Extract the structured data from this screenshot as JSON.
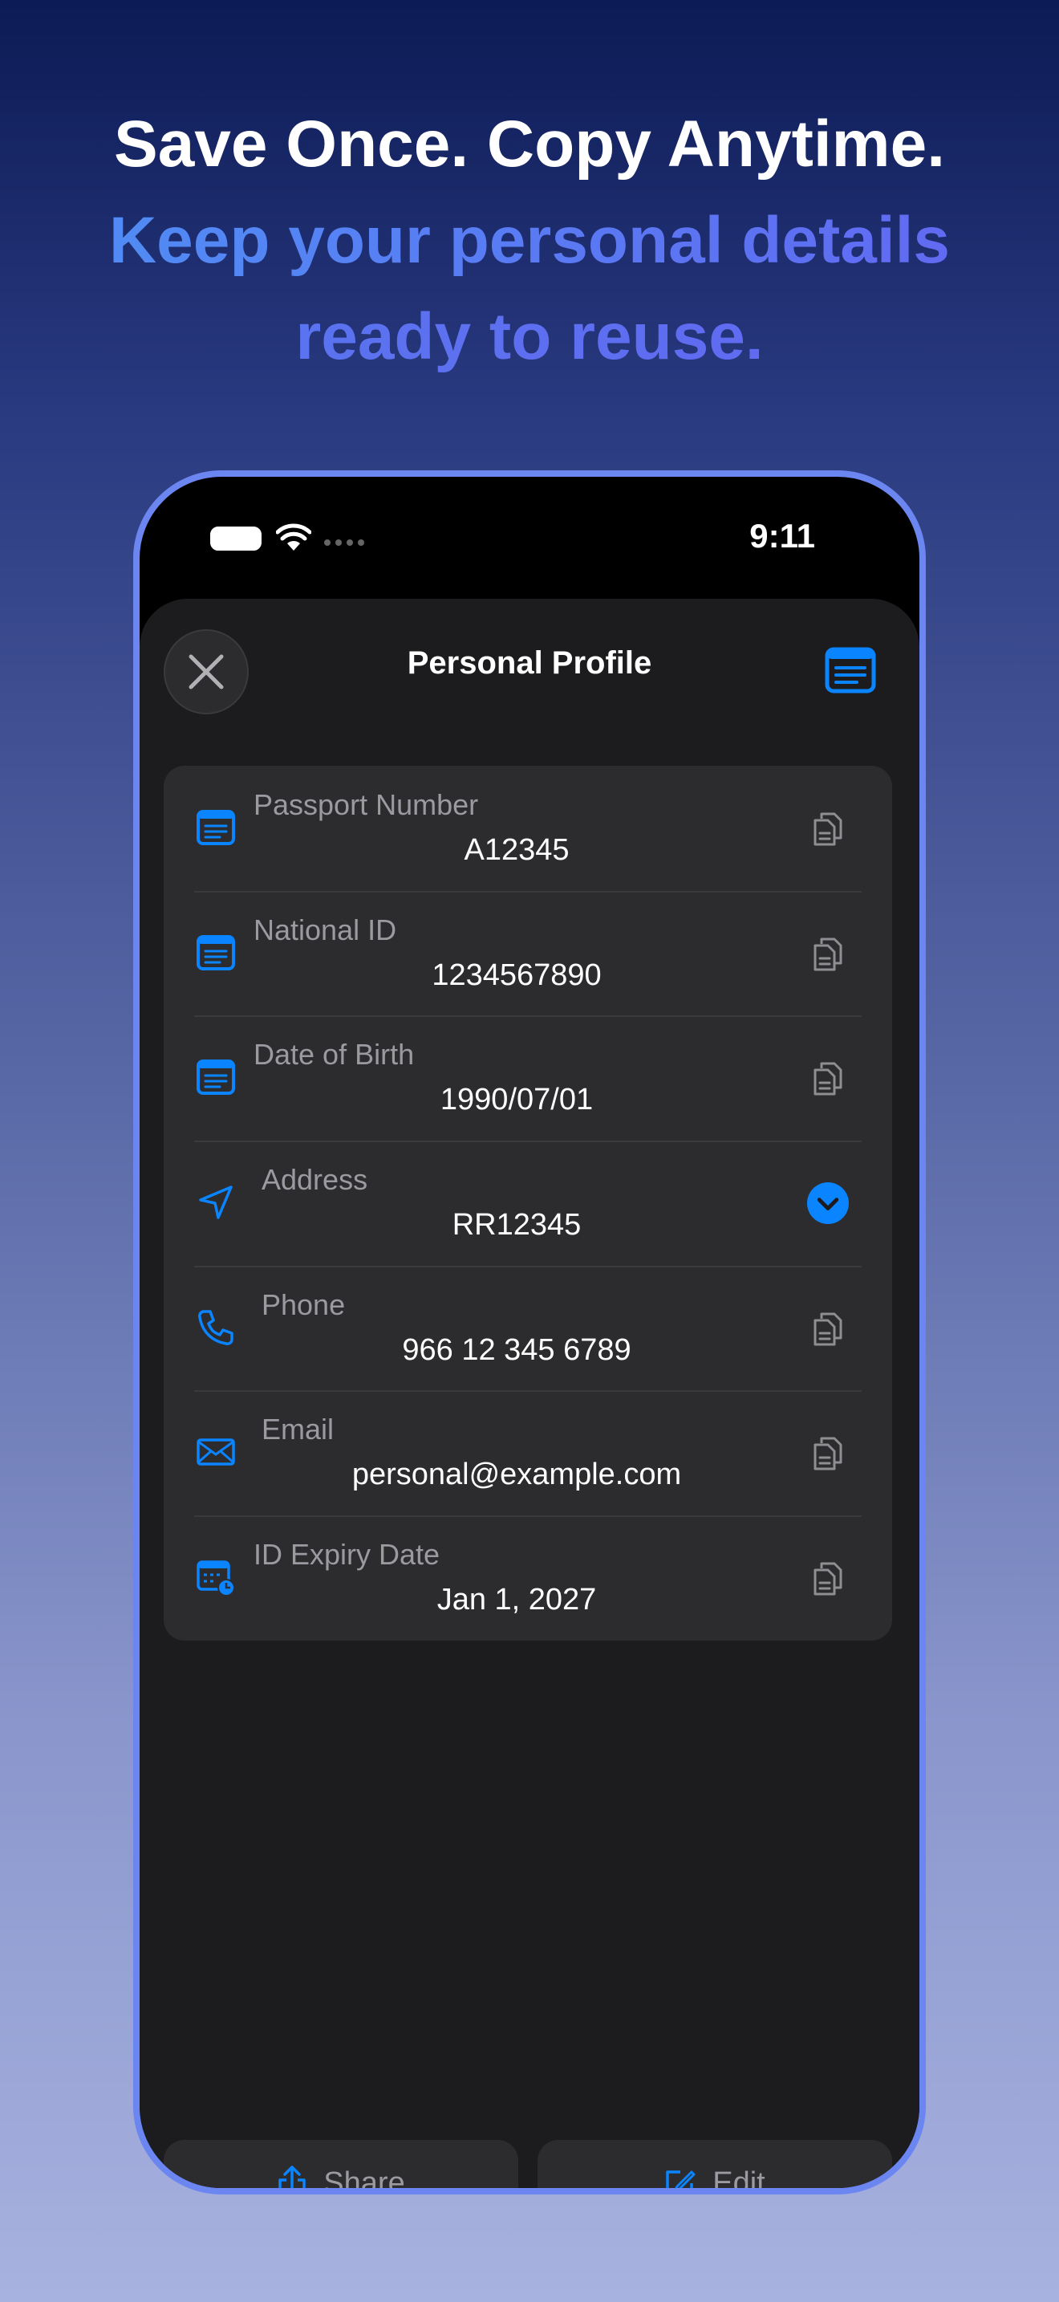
{
  "hero": {
    "line1": "Save Once. Copy Anytime.",
    "line2": "Keep your personal details",
    "line3": "ready to reuse."
  },
  "status_bar": {
    "time": "9:11"
  },
  "sheet": {
    "title": "Personal Profile"
  },
  "fields": [
    {
      "label": "Passport Number",
      "value": "A12345",
      "icon": "document-card-icon",
      "action": "copy-icon"
    },
    {
      "label": "National ID",
      "value": "1234567890",
      "icon": "document-card-icon",
      "action": "copy-icon"
    },
    {
      "label": "Date of Birth",
      "value": "1990/07/01",
      "icon": "document-card-icon",
      "action": "copy-icon"
    },
    {
      "label": "Address",
      "value": "RR12345",
      "icon": "location-arrow-icon",
      "action": "chevron-down-icon"
    },
    {
      "label": "Phone",
      "value": "966 12 345 6789",
      "icon": "phone-icon",
      "action": "copy-icon"
    },
    {
      "label": "Email",
      "value": "personal@example.com",
      "icon": "envelope-icon",
      "action": "copy-icon"
    },
    {
      "label": "ID Expiry Date",
      "value": "Jan 1, 2027",
      "icon": "calendar-clock-icon",
      "action": "copy-icon"
    }
  ],
  "actions": {
    "share_label": "Share",
    "edit_label": "Edit"
  },
  "colors": {
    "accent": "#0a84ff",
    "frame": "#6b86f0",
    "sheet_bg": "#1c1c1e",
    "card_bg": "#2c2c2e"
  }
}
